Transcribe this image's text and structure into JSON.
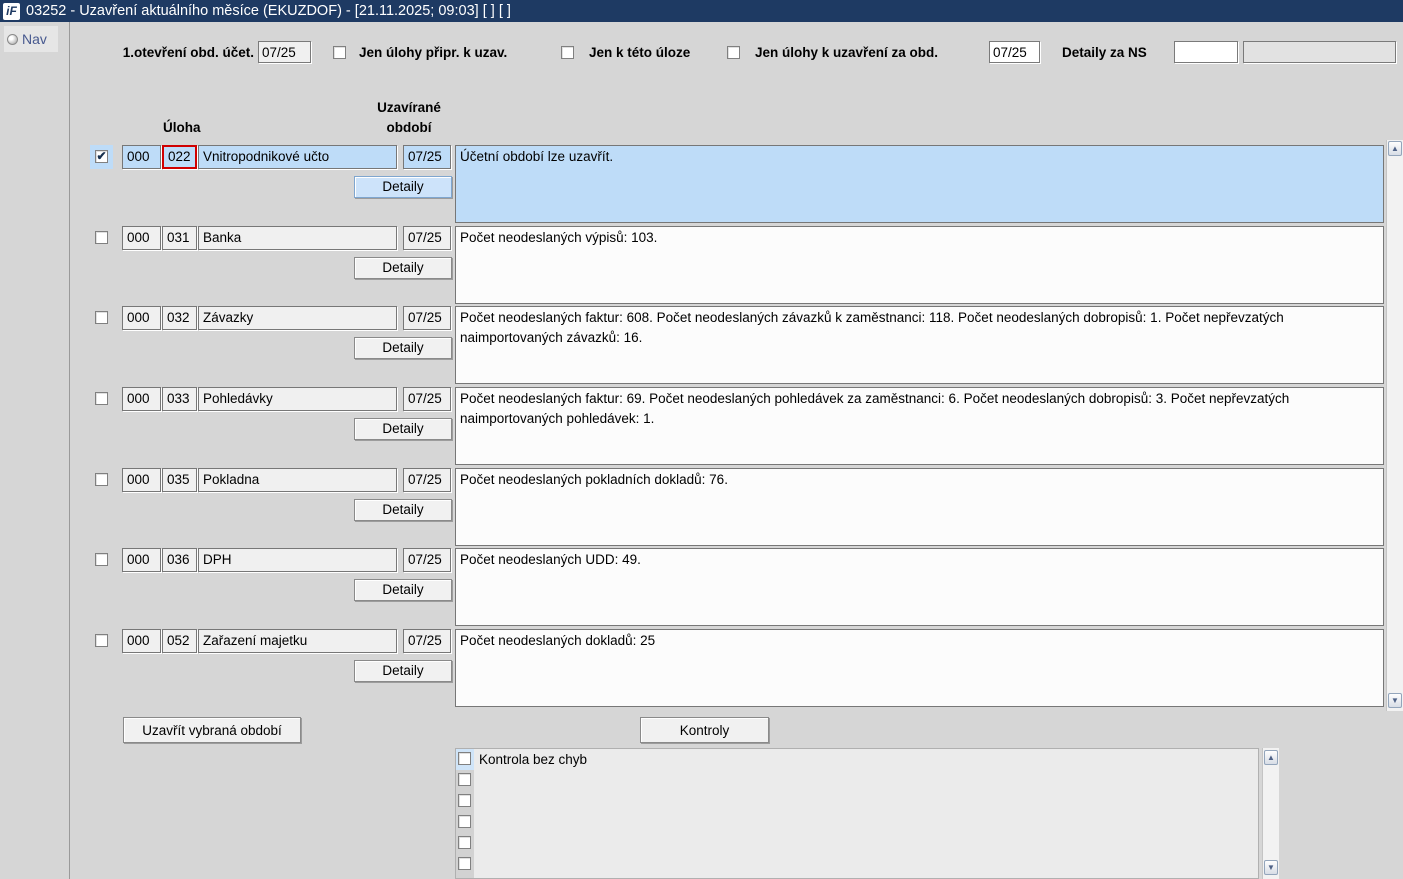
{
  "window": {
    "icon_text": "iF",
    "title": "03252 - Uzavření aktuálního měsíce (EKUZDOF) - [21.11.2025; 09:03]  [ ]  [ ]"
  },
  "sidebar": {
    "nav_label": "Nav"
  },
  "filter_bar": {
    "open_period_label": "1.otevření obd. účet.",
    "open_period_value": "07/25",
    "only_ready_label": "Jen úlohy připr. k uzav.",
    "only_this_task_label": "Jen k této úloze",
    "only_close_period_label": "Jen úlohy k uzavření za obd.",
    "close_period_value": "07/25",
    "details_ns_label": "Detaily za NS",
    "details_ns_value": "",
    "details_ns_value2": ""
  },
  "table": {
    "col_uloha": "Úloha",
    "col_obdobi_line1": "Uzavírané",
    "col_obdobi_line2": "období",
    "detaily_label": "Detaily",
    "rows": [
      {
        "checked": true,
        "selected": true,
        "focused_field": "code2",
        "code1": "000",
        "code2": "022",
        "name": "Vnitropodnikové učto",
        "period": "07/25",
        "message": "Účetní období lze uzavřít."
      },
      {
        "checked": false,
        "selected": false,
        "code1": "000",
        "code2": "031",
        "name": "Banka",
        "period": "07/25",
        "message": "Počet neodeslaných výpisů: 103."
      },
      {
        "checked": false,
        "selected": false,
        "code1": "000",
        "code2": "032",
        "name": "Závazky",
        "period": "07/25",
        "message": "Počet neodeslaných faktur: 608. Počet neodeslaných závazků k zaměstnanci: 118. Počet neodeslaných dobropisů: 1. Počet nepřevzatých naimportovaných závazků: 16."
      },
      {
        "checked": false,
        "selected": false,
        "code1": "000",
        "code2": "033",
        "name": "Pohledávky",
        "period": "07/25",
        "message": "Počet neodeslaných faktur: 69. Počet neodeslaných pohledávek za zaměstnanci: 6. Počet neodeslaných dobropisů: 3. Počet nepřevzatých naimportovaných pohledávek: 1."
      },
      {
        "checked": false,
        "selected": false,
        "code1": "000",
        "code2": "035",
        "name": "Pokladna",
        "period": "07/25",
        "message": "Počet neodeslaných pokladních dokladů: 76."
      },
      {
        "checked": false,
        "selected": false,
        "code1": "000",
        "code2": "036",
        "name": "DPH",
        "period": "07/25",
        "message": "Počet neodeslaných UDD: 49."
      },
      {
        "checked": false,
        "selected": false,
        "code1": "000",
        "code2": "052",
        "name": "Zařazení majetku",
        "period": "07/25",
        "message": "Počet neodeslaných dokladů: 25"
      }
    ]
  },
  "actions": {
    "close_selected_label": "Uzavřít vybraná období",
    "kontroly_label": "Kontroly"
  },
  "checks_list": {
    "visible_rows": 6,
    "items": [
      {
        "label": "Kontrola bez chyb",
        "checked": false,
        "highlighted": true
      }
    ]
  },
  "icons": {
    "arrow_up": "▲",
    "arrow_down": "▼",
    "checkmark": "✔"
  },
  "colors": {
    "titlebar": "#1e3a63",
    "selected_row": "#bedcf8",
    "focus_border": "#d00000",
    "window_bg": "#d6d6d6"
  }
}
